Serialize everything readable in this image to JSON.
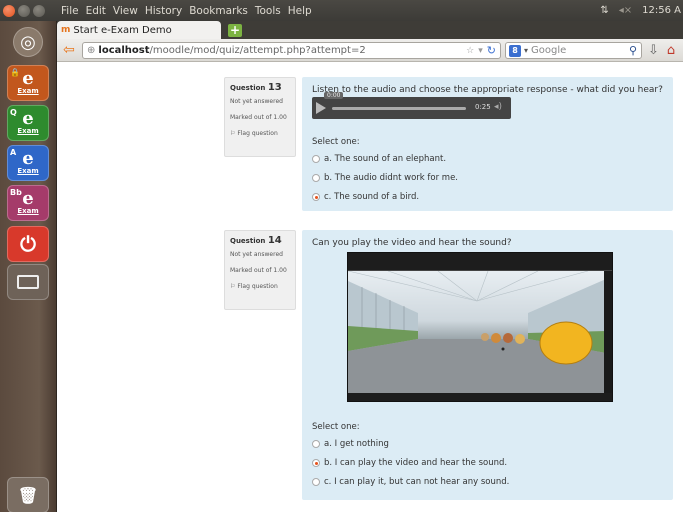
{
  "system": {
    "menu": [
      "File",
      "Edit",
      "View",
      "History",
      "Bookmarks",
      "Tools",
      "Help"
    ],
    "clock": "12:56 A"
  },
  "launcher": {
    "items": [
      {
        "tag": "🔒",
        "letter": "e",
        "label": "Exam",
        "color": "#c2571d"
      },
      {
        "tag": "Q",
        "letter": "e",
        "label": "Exam",
        "color": "#2e8b2e"
      },
      {
        "tag": "A",
        "letter": "e",
        "label": "Exam",
        "color": "#2f67c8"
      },
      {
        "tag": "Bb",
        "letter": "e",
        "label": "Exam",
        "color": "#a53b6a"
      }
    ]
  },
  "browser": {
    "tab_title": "Start e-Exam Demo",
    "url_host": "localhost",
    "url_path": "/moodle/mod/quiz/attempt.php?attempt=2",
    "search_placeholder": "Google"
  },
  "questions": [
    {
      "label": "Question",
      "number": "13",
      "status": "Not yet answered",
      "marks": "Marked out of 1.00",
      "flag": "Flag question",
      "text": "Listen to the audio and choose the appropriate response - what did you hear?",
      "audio_tip": "0:00",
      "audio_time": "0:25",
      "select": "Select one:",
      "options": [
        {
          "label": "a. The sound of an elephant.",
          "selected": false
        },
        {
          "label": "b. The audio didnt work for me.",
          "selected": false
        },
        {
          "label": "c. The sound of a bird.",
          "selected": true
        }
      ]
    },
    {
      "label": "Question",
      "number": "14",
      "status": "Not yet answered",
      "marks": "Marked out of 1.00",
      "flag": "Flag question",
      "text": "Can you play the video and hear the sound?",
      "select": "Select one:",
      "options": [
        {
          "label": "a. I get nothing",
          "selected": false
        },
        {
          "label": "b. I can play the video and hear the sound.",
          "selected": true
        },
        {
          "label": "c. I can play it, but can not hear any sound.",
          "selected": false
        }
      ]
    }
  ],
  "colors": {
    "accent": "#e5521d",
    "question_bg": "#dcecf5",
    "info_bg": "#f0f0f0"
  }
}
